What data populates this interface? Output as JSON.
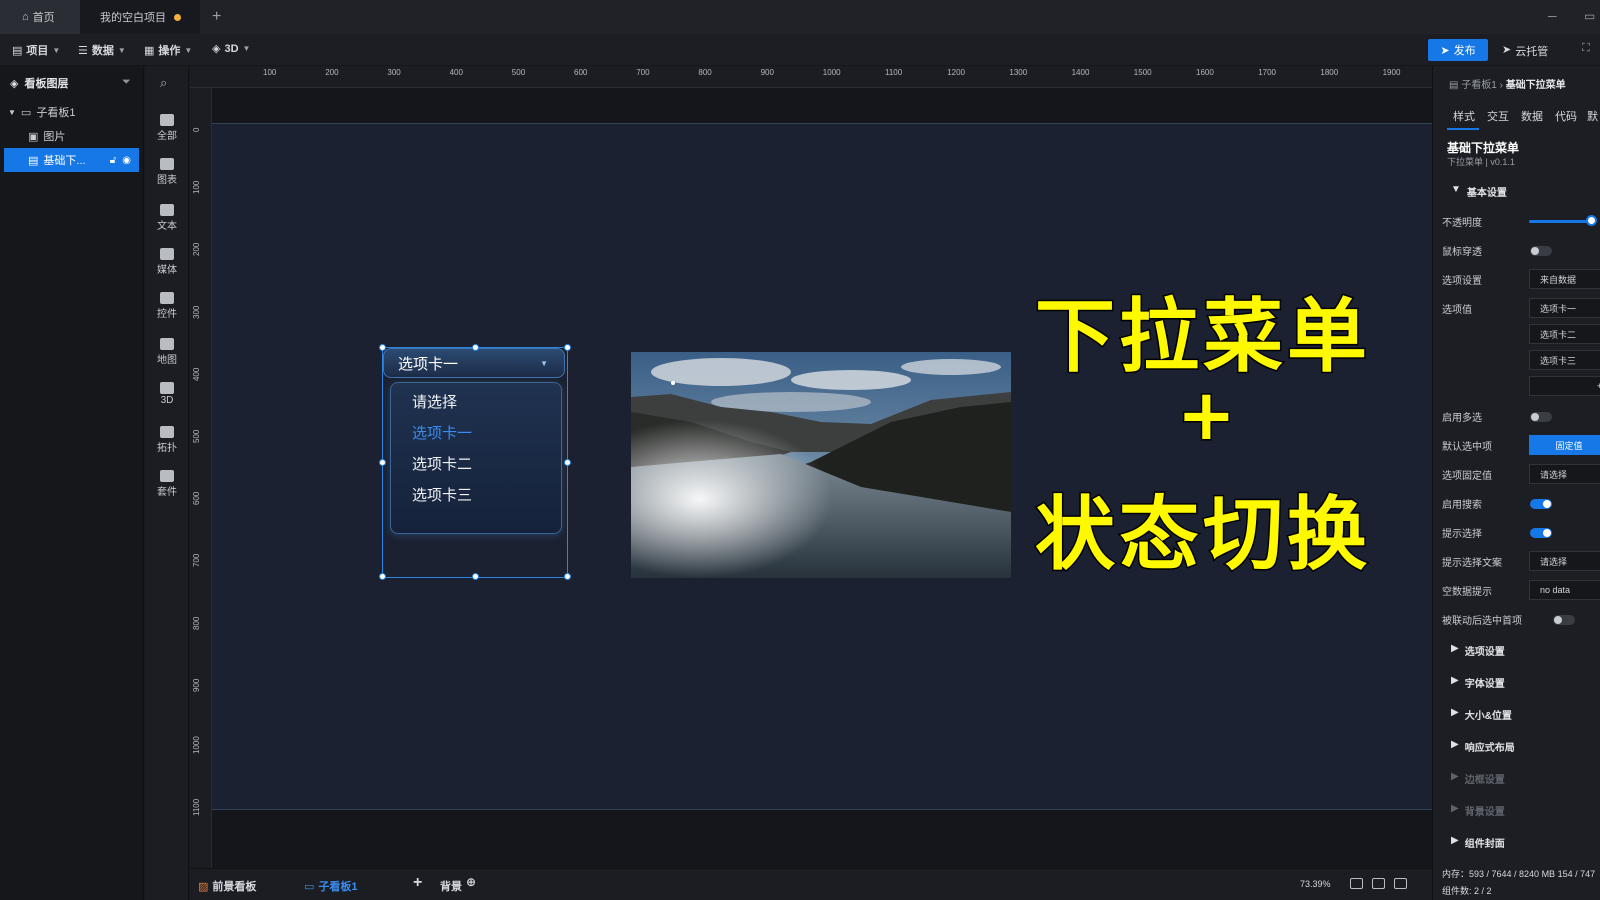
{
  "tabs": {
    "home": "首页",
    "project": "我的空白项目",
    "add": "+"
  },
  "window": {
    "minimize": "─",
    "restore": "▭"
  },
  "menu": {
    "project": "项目",
    "data": "数据",
    "operate": "操作",
    "three_d": "3D",
    "publish": "发布",
    "cloud": "云托管"
  },
  "layers": {
    "title": "看板图层",
    "items": [
      {
        "label": "子看板1"
      },
      {
        "label": "图片"
      },
      {
        "label": "基础下..."
      }
    ]
  },
  "components": {
    "items": [
      {
        "label": "全部"
      },
      {
        "label": "图表"
      },
      {
        "label": "文本"
      },
      {
        "label": "媒体"
      },
      {
        "label": "控件"
      },
      {
        "label": "地图"
      },
      {
        "label": "3D"
      },
      {
        "label": "拓扑"
      },
      {
        "label": "套件"
      }
    ]
  },
  "ruler": {
    "top": [
      "100",
      "200",
      "300",
      "400",
      "500",
      "600",
      "700",
      "800",
      "900",
      "1000",
      "1100",
      "1200",
      "1300",
      "1400",
      "1500",
      "1600",
      "1700",
      "1800",
      "1900"
    ],
    "left": [
      "0",
      "100",
      "200",
      "300",
      "400",
      "500",
      "600",
      "700",
      "800",
      "900",
      "1000",
      "1100"
    ]
  },
  "dropdown": {
    "selected": "选项卡一",
    "options": [
      "请选择",
      "选项卡一",
      "选项卡二",
      "选项卡三"
    ],
    "highlight_color": "#3b8cf0"
  },
  "overlay": {
    "line1": "下拉菜单",
    "plus": "+",
    "line2": "状态切换",
    "color": "#fff900"
  },
  "bottom": {
    "foreground": "前景看板",
    "subboard": "子看板1",
    "add": "+",
    "background": "背景",
    "zoom": "73.39%"
  },
  "props": {
    "breadcrumb_parent": "子看板1",
    "breadcrumb_current": "基础下拉菜单",
    "tabs": [
      "样式",
      "交互",
      "数据",
      "代码",
      "默"
    ],
    "title": "基础下拉菜单",
    "subtitle": "下拉菜单 | v0.1.1",
    "basic_section": "基本设置",
    "rows": {
      "opacity": "不透明度",
      "mouse_through": "鼠标穿透",
      "option_setting": "选项设置",
      "option_value": "选项值",
      "multi": "启用多选",
      "default_selected": "默认选中项",
      "fixed_value": "选项固定值",
      "search": "启用搜索",
      "hint": "提示选择",
      "hint_text": "提示选择文案",
      "empty_hint": "空数据提示",
      "linked_first": "被联动后选中首项"
    },
    "fields": {
      "option_source": "来自数据",
      "opt1": "选项卡一",
      "opt2": "选项卡二",
      "opt3": "选项卡三",
      "add": "+",
      "default_mode": "固定值",
      "fixed_value": "请选择",
      "hint_text": "请选择",
      "empty_text": "no data"
    },
    "sections": [
      "选项设置",
      "字体设置",
      "大小&位置",
      "响应式布局",
      "边框设置",
      "背景设置",
      "组件封面"
    ],
    "memory": "内存：593 / 7644 / 8240 MB  154 / 747",
    "component_count": "组件数: 2 / 2"
  }
}
